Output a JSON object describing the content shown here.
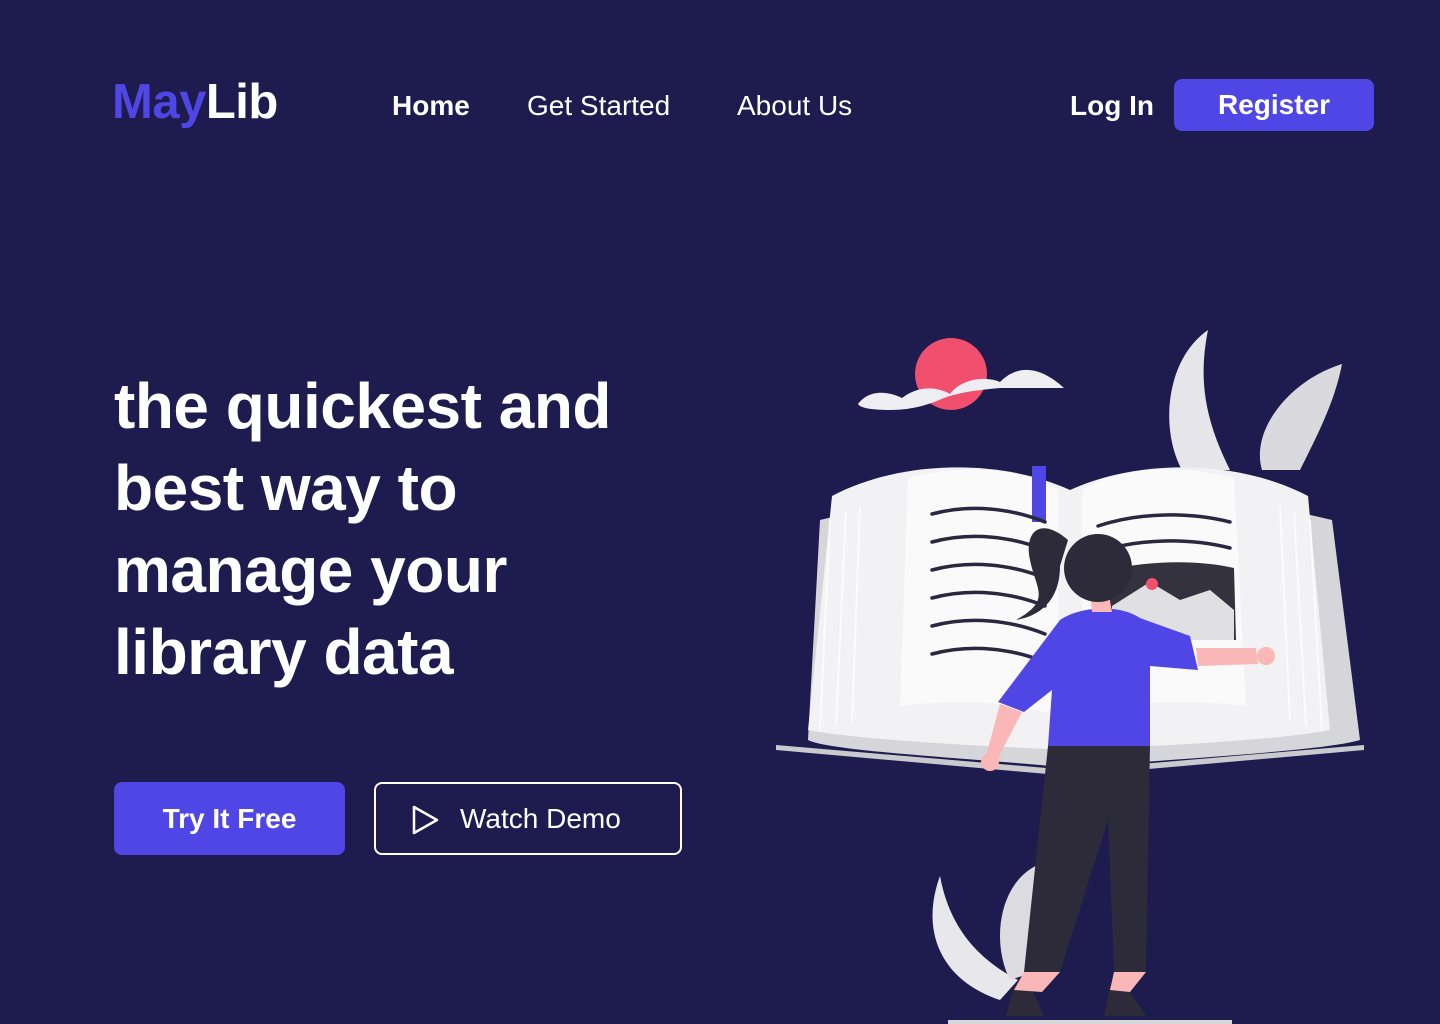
{
  "logo": {
    "part1": "May",
    "part2": "Lib"
  },
  "nav": {
    "items": [
      {
        "label": "Home",
        "active": true
      },
      {
        "label": "Get Started",
        "active": false
      },
      {
        "label": "About Us",
        "active": false
      }
    ]
  },
  "auth": {
    "login_label": "Log In",
    "register_label": "Register"
  },
  "hero": {
    "title_lines": [
      "the quickest and",
      "best way to",
      "manage your",
      "library data"
    ],
    "primary_cta": "Try It Free",
    "secondary_cta": "Watch Demo",
    "secondary_cta_icon": "play-icon"
  },
  "colors": {
    "background": "#1e1b4f",
    "accent": "#4f46e5",
    "text": "#ffffff",
    "sun": "#f0506e"
  }
}
